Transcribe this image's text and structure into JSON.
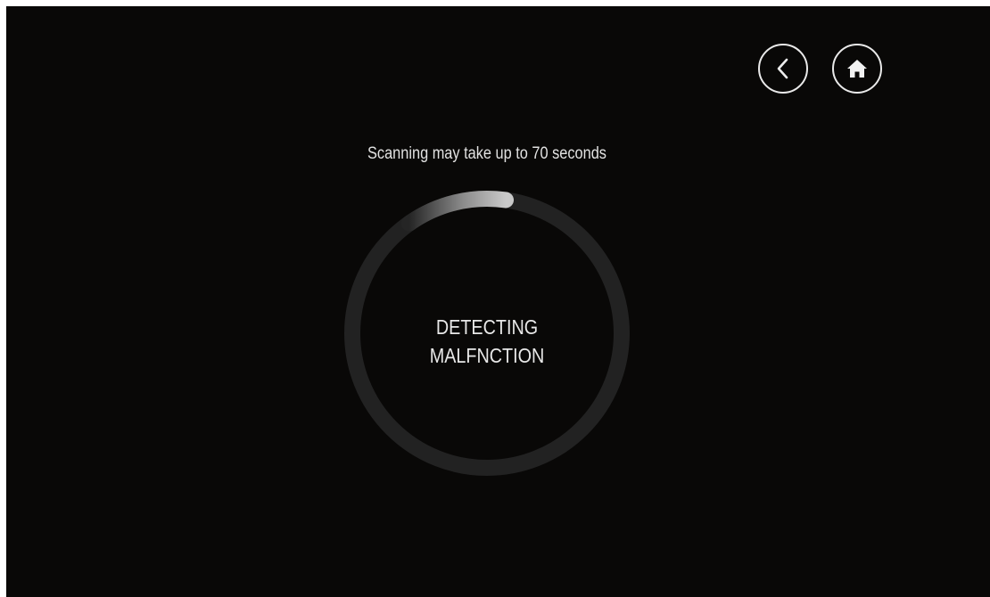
{
  "nav": {
    "back_icon": "chevron-left-icon",
    "home_icon": "home-icon"
  },
  "scan": {
    "hint": "Scanning may take up to 70 seconds",
    "status_line1": "DETECTING",
    "status_line2": "MALFNCTION",
    "progress_fraction": 0.12
  },
  "colors": {
    "background": "#090807",
    "ring_track": "#242424",
    "ring_progress": "#c8c8c8",
    "text": "#e8e8e8"
  }
}
